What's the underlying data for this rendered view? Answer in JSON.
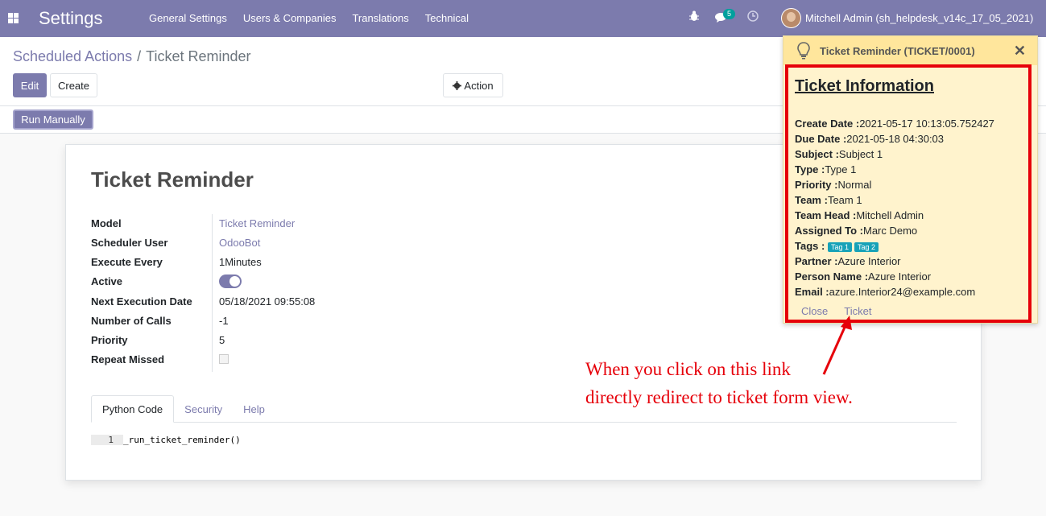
{
  "navbar": {
    "brand": "Settings",
    "menu": [
      "General Settings",
      "Users & Companies",
      "Translations",
      "Technical"
    ],
    "chat_count": "5",
    "user_name": "Mitchell Admin (sh_helpdesk_v14c_17_05_2021)",
    "color": "#7c7bad"
  },
  "control": {
    "breadcrumb_parent": "Scheduled Actions",
    "breadcrumb_sep": "/",
    "breadcrumb_current": "Ticket Reminder",
    "edit": "Edit",
    "create": "Create",
    "action": "Action",
    "run_manually": "Run Manually"
  },
  "form": {
    "title": "Ticket Reminder",
    "fields": [
      {
        "label": "Model",
        "value": "Ticket Reminder"
      },
      {
        "label": "Scheduler User",
        "value": "OdooBot"
      },
      {
        "label": "Execute Every",
        "value": "1Minutes"
      },
      {
        "label": "Active",
        "value": ""
      },
      {
        "label": "Next Execution Date",
        "value": "05/18/2021 09:55:08"
      },
      {
        "label": "Number of Calls",
        "value": "-1"
      },
      {
        "label": "Priority",
        "value": "5"
      },
      {
        "label": "Repeat Missed",
        "value": ""
      }
    ],
    "active": true,
    "repeat_missed": false,
    "tabs": [
      "Python Code",
      "Security",
      "Help"
    ],
    "code_line_no": "1",
    "code": "_run_ticket_reminder()"
  },
  "popup": {
    "title": "Ticket Reminder (TICKET/0001)",
    "info_title": "Ticket Information",
    "lines": [
      {
        "label": "Create Date :",
        "value": "2021-05-17 10:13:05.752427"
      },
      {
        "label": "Due Date :",
        "value": "2021-05-18 04:30:03"
      },
      {
        "label": "Subject :",
        "value": "Subject 1"
      },
      {
        "label": "Type :",
        "value": "Type 1"
      },
      {
        "label": "Priority :",
        "value": "Normal"
      },
      {
        "label": "Team :",
        "value": "Team 1"
      },
      {
        "label": "Team Head :",
        "value": "Mitchell Admin"
      },
      {
        "label": "Assigned To :",
        "value": "Marc Demo"
      },
      {
        "label": "Tags :",
        "value": ""
      },
      {
        "label": "Partner :",
        "value": "Azure Interior"
      },
      {
        "label": "Person Name :",
        "value": "Azure Interior"
      },
      {
        "label": "Email :",
        "value": "azure.Interior24@example.com"
      }
    ],
    "tags": [
      "Tag 1",
      "Tag 2"
    ],
    "close": "Close",
    "ticket": "Ticket"
  },
  "annotation": {
    "line1": "When you click on this link",
    "line2": "directly redirect to ticket form view.",
    "color": "#e6000a"
  }
}
